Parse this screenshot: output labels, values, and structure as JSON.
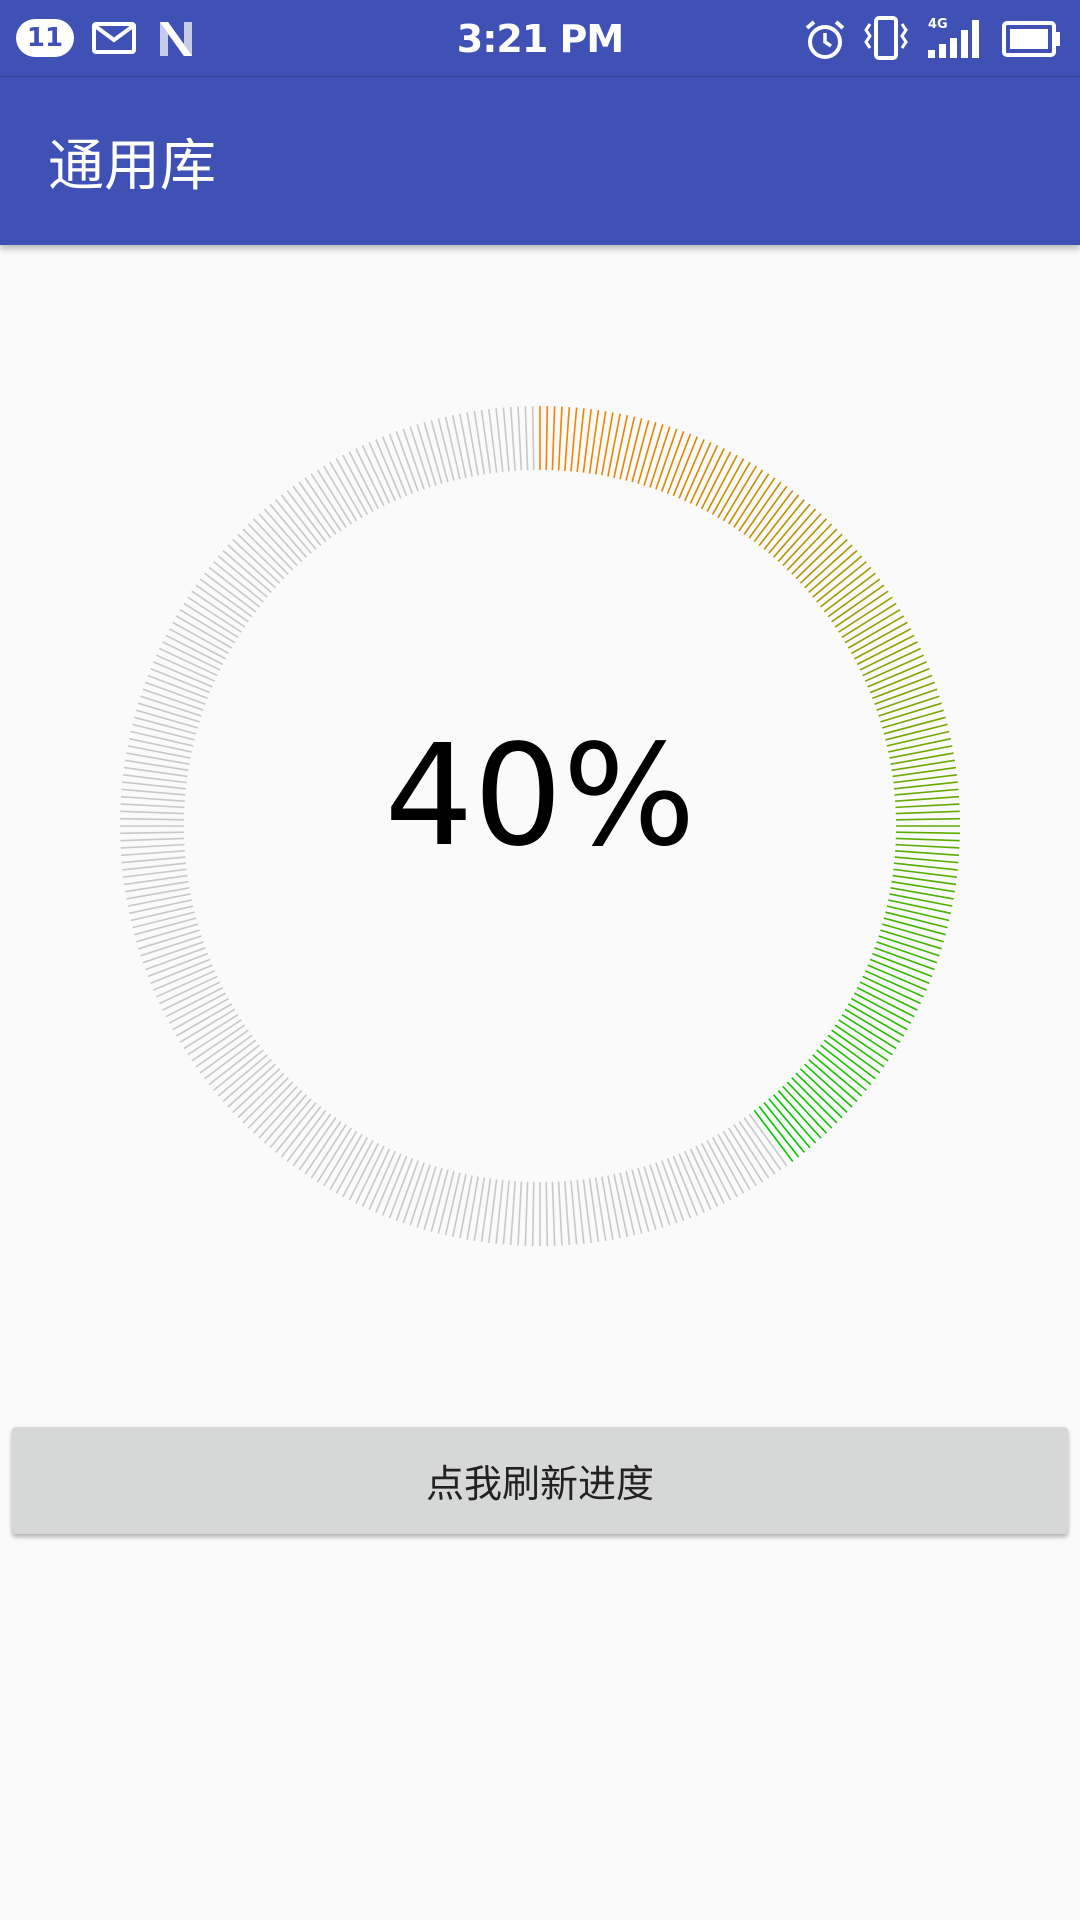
{
  "status_bar": {
    "notification_count": "11",
    "time": "3:21 PM",
    "network_label": "4G",
    "icons": [
      "mail-icon",
      "n-icon",
      "alarm-icon",
      "vibrate-icon",
      "signal-icon",
      "battery-icon"
    ]
  },
  "app_bar": {
    "title": "通用库"
  },
  "progress": {
    "value": 40,
    "label": "40%",
    "track_color": "#c8c8c8",
    "gradient_start_color": "#ff7f00",
    "gradient_end_color": "#00c800"
  },
  "button": {
    "label": "点我刷新进度"
  },
  "colors": {
    "primary": "#3f51b5",
    "background": "#fafafa",
    "button_bg": "#d6d7d7"
  }
}
